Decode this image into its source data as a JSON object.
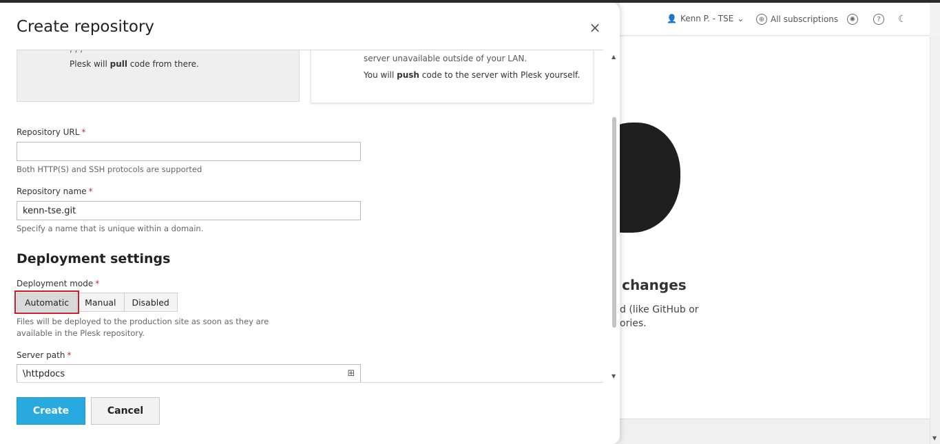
{
  "background": {
    "header": {
      "user_label": "Kenn P. - TSE",
      "user_chevron": "⌄",
      "subscriptions_label": "All subscriptions",
      "icons": [
        "user-icon",
        "globe-icon",
        "extensions-icon",
        "help-icon",
        "moon-icon"
      ]
    },
    "empty_state": {
      "title_fragment": "te changes",
      "text_line1": "d (like GitHub or",
      "text_line2": "ories."
    }
  },
  "modal": {
    "title": "Create repository",
    "close_label": "×",
    "remote_card": {
      "line_fragment": ", , ,",
      "pull_prefix": "Plesk will ",
      "pull_bold": "pull",
      "pull_suffix": " code from there."
    },
    "local_card": {
      "line1": "server unavailable outside of your LAN.",
      "push_prefix": "You will ",
      "push_bold": "push",
      "push_suffix": " code to the server with Plesk yourself."
    },
    "repository_url": {
      "label": "Repository URL",
      "required_mark": "*",
      "value": "",
      "hint": "Both HTTP(S) and SSH protocols are supported"
    },
    "repository_name": {
      "label": "Repository name",
      "required_mark": "*",
      "value": "kenn-tse.git",
      "hint": "Specify a name that is unique within a domain."
    },
    "deployment": {
      "section_title": "Deployment settings",
      "mode_label": "Deployment mode",
      "required_mark": "*",
      "modes": [
        "Automatic",
        "Manual",
        "Disabled"
      ],
      "selected_mode": "Automatic",
      "hint_line1": "Files will be deployed to the production site as soon as they are",
      "hint_line2": "available in the Plesk repository."
    },
    "server_path": {
      "label": "Server path",
      "required_mark": "*",
      "value": "\\httpdocs"
    },
    "buttons": {
      "create": "Create",
      "cancel": "Cancel"
    },
    "colors": {
      "primary": "#28a9e0",
      "highlight": "#d9161c",
      "required": "#d02b2b"
    }
  }
}
